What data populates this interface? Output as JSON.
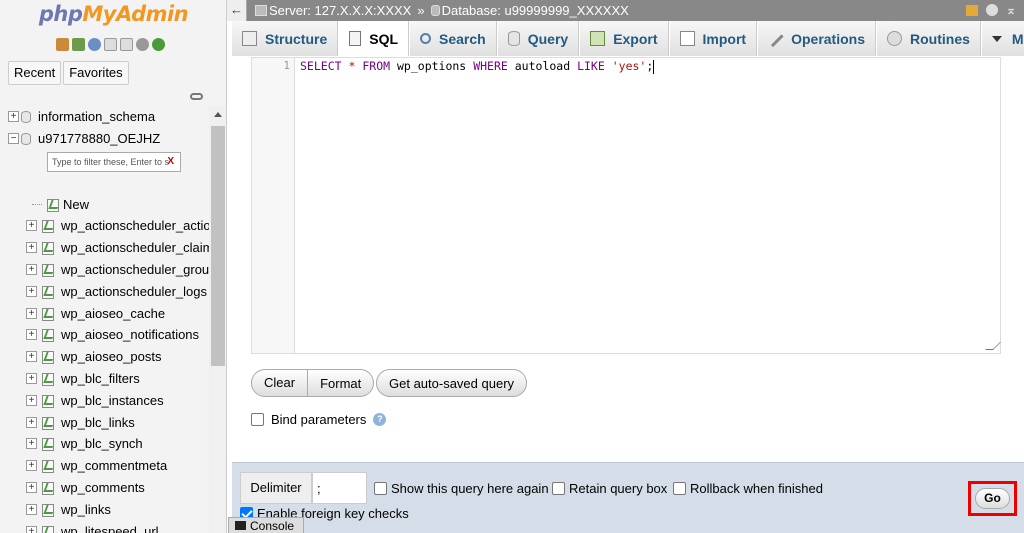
{
  "logo": {
    "part1": "php",
    "part2": "MyAdmin"
  },
  "nav_tabs": [
    "Recent",
    "Favorites"
  ],
  "tree": {
    "databases": [
      "information_schema",
      "u971778880_OEJHZ"
    ],
    "filter_placeholder": "Type to filter these, Enter to s",
    "filter_clear": "X",
    "new_label": "New",
    "tables": [
      "wp_actionscheduler_actions",
      "wp_actionscheduler_claims",
      "wp_actionscheduler_groups",
      "wp_actionscheduler_logs",
      "wp_aioseo_cache",
      "wp_aioseo_notifications",
      "wp_aioseo_posts",
      "wp_blc_filters",
      "wp_blc_instances",
      "wp_blc_links",
      "wp_blc_synch",
      "wp_commentmeta",
      "wp_comments",
      "wp_links",
      "wp_litespeed_url"
    ]
  },
  "topbar": {
    "back": "←",
    "server": "Server: 127.X.X.X:XXXX",
    "separator": "»",
    "database": "Database: u99999999_XXXXXX"
  },
  "tabs": [
    "Structure",
    "SQL",
    "Search",
    "Query",
    "Export",
    "Import",
    "Operations",
    "Routines",
    "More"
  ],
  "editor": {
    "line_number": "1",
    "tokens": {
      "k1": "SELECT",
      "star": "*",
      "k2": "FROM",
      "table": "wp_options",
      "k3": "WHERE",
      "col": "autoload",
      "k4": "LIKE",
      "val": "'yes'",
      "semi": ";"
    }
  },
  "buttons": {
    "clear": "Clear",
    "format": "Format",
    "autosaved": "Get auto-saved query",
    "go": "Go"
  },
  "bind_parameters": "Bind parameters",
  "footer": {
    "delimiter_label": "Delimiter",
    "delimiter_value": ";",
    "show_query": "Show this query here again",
    "retain_box": "Retain query box",
    "rollback": "Rollback when finished",
    "foreign_keys": "Enable foreign key checks"
  },
  "console": "Console",
  "colors": {
    "accent": "#235a81",
    "highlight_border": "#e00000",
    "footer_bg": "#d5dee8"
  }
}
